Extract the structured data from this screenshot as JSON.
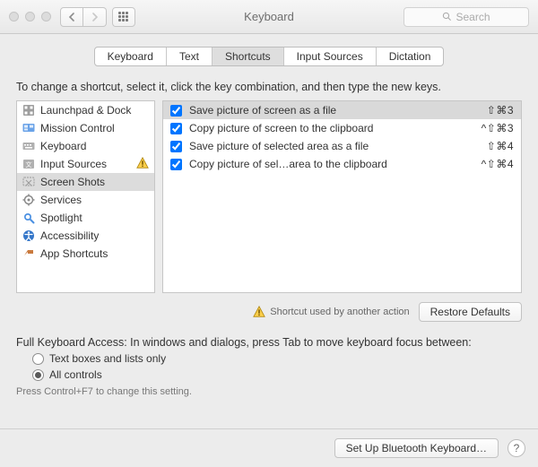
{
  "window": {
    "title": "Keyboard",
    "search_placeholder": "Search"
  },
  "tabs": [
    {
      "label": "Keyboard"
    },
    {
      "label": "Text"
    },
    {
      "label": "Shortcuts",
      "active": true
    },
    {
      "label": "Input Sources"
    },
    {
      "label": "Dictation"
    }
  ],
  "instructions": "To change a shortcut, select it, click the key combination, and then type the new keys.",
  "categories": [
    {
      "label": "Launchpad & Dock",
      "icon": "launchpad",
      "warning": false
    },
    {
      "label": "Mission Control",
      "icon": "mission-control",
      "warning": false
    },
    {
      "label": "Keyboard",
      "icon": "keyboard",
      "warning": false
    },
    {
      "label": "Input Sources",
      "icon": "input-sources",
      "warning": true
    },
    {
      "label": "Screen Shots",
      "icon": "screenshots",
      "selected": true,
      "warning": false
    },
    {
      "label": "Services",
      "icon": "services",
      "warning": false
    },
    {
      "label": "Spotlight",
      "icon": "spotlight",
      "warning": false
    },
    {
      "label": "Accessibility",
      "icon": "accessibility",
      "warning": false
    },
    {
      "label": "App Shortcuts",
      "icon": "app-shortcuts",
      "warning": false
    }
  ],
  "shortcuts": [
    {
      "checked": true,
      "label": "Save picture of screen as a file",
      "keys": "⇧⌘3",
      "selected": true
    },
    {
      "checked": true,
      "label": "Copy picture of screen to the clipboard",
      "keys": "^⇧⌘3"
    },
    {
      "checked": true,
      "label": "Save picture of selected area as a file",
      "keys": "⇧⌘4"
    },
    {
      "checked": true,
      "label": "Copy picture of sel…area to the clipboard",
      "keys": "^⇧⌘4"
    }
  ],
  "legend": "Shortcut used by another action",
  "restore_label": "Restore Defaults",
  "fka_heading": "Full Keyboard Access: In windows and dialogs, press Tab to move keyboard focus between:",
  "fka_options": [
    {
      "label": "Text boxes and lists only",
      "checked": false
    },
    {
      "label": "All controls",
      "checked": true
    }
  ],
  "fka_hint": "Press Control+F7 to change this setting.",
  "footer": {
    "setup_label": "Set Up Bluetooth Keyboard…",
    "help": "?"
  }
}
